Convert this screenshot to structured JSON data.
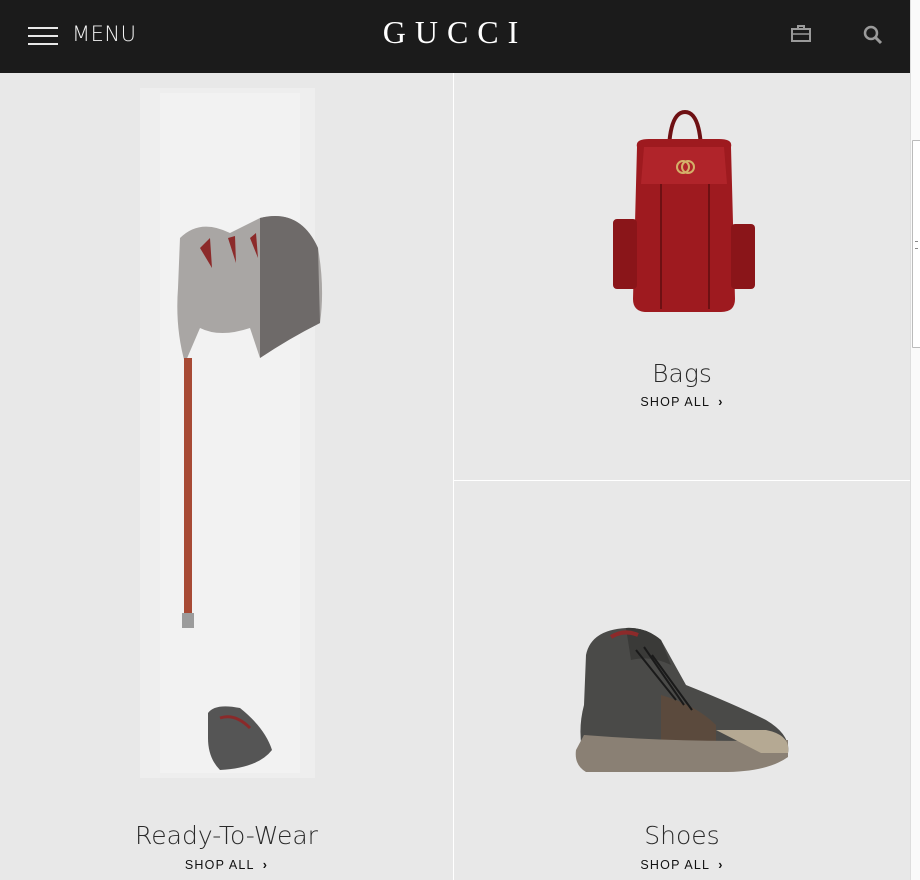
{
  "header": {
    "menu_label": "MENU",
    "logo": "GUCCI",
    "icons": [
      "hamburger-icon",
      "shopping-bag-icon",
      "search-icon"
    ]
  },
  "categories": [
    {
      "title": "Ready-To-Wear",
      "cta": "SHOP ALL",
      "icon": "chevron-right-icon"
    },
    {
      "title": "Bags",
      "cta": "SHOP ALL",
      "icon": "chevron-right-icon"
    },
    {
      "title": "Shoes",
      "cta": "SHOP ALL",
      "icon": "chevron-right-icon"
    }
  ],
  "colors": {
    "header_bg": "#1b1b1b",
    "page_bg": "#e8e8e8",
    "bag_red": "#9e1a1f"
  }
}
